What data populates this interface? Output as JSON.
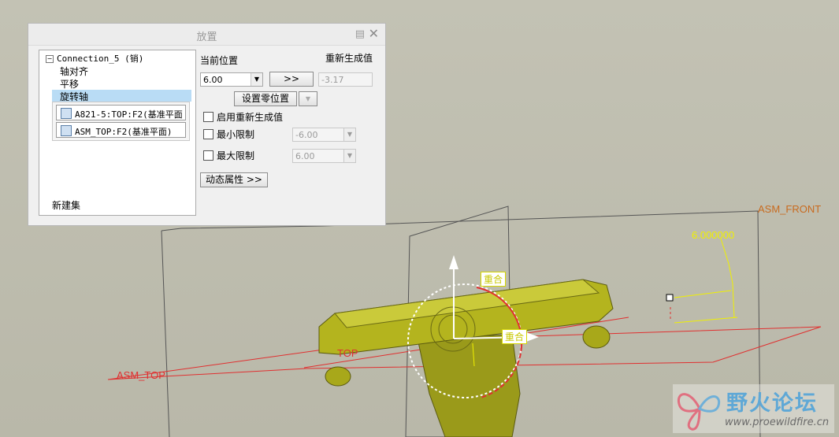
{
  "dialog": {
    "title": "放置",
    "close_icon": "close-icon",
    "pin_icon": "pin-icon",
    "tree": {
      "root_label": "Connection_5 (销)",
      "items": [
        "轴对齐",
        "平移",
        "旋转轴"
      ],
      "selected": "旋转轴",
      "refs": [
        "A821-5:TOP:F2(基准平面",
        "ASM_TOP:F2(基准平面)"
      ],
      "new_set": "新建集"
    },
    "current_position_label": "当前位置",
    "current_position_value": "6.00",
    "arrow_button": ">>",
    "regen_value_label": "重新生成值",
    "regen_value": "-3.17",
    "set_zero_button": "设置零位置",
    "enable_regen_label": "启用重新生成值",
    "min_limit_label": "最小限制",
    "min_limit_value": "-6.00",
    "max_limit_label": "最大限制",
    "max_limit_value": "6.00",
    "dynamic_props_button": "动态属性 >>"
  },
  "viewport": {
    "labels": {
      "asm_front": "ASM_FRONT",
      "asm_top": "ASM_TOP",
      "top": "TOP",
      "dimension": "6.000000",
      "coincident_1": "重合",
      "coincident_2": "重合"
    },
    "colors": {
      "part": "#b4b41e",
      "datum_red": "#e03030",
      "datum_dark": "#555555",
      "dimension_yellow": "#f0f000",
      "front_label": "#c86a1e"
    }
  },
  "watermark": {
    "title": "野火论坛",
    "url": "www.proewildfire.cn"
  }
}
